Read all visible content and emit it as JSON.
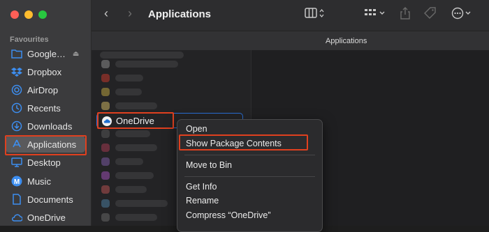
{
  "window": {
    "title": "Applications",
    "path_label": "Applications"
  },
  "sidebar": {
    "section": "Favourites",
    "items": [
      {
        "label": "Google…",
        "icon": "folder-icon"
      },
      {
        "label": "Dropbox",
        "icon": "dropbox-icon"
      },
      {
        "label": "AirDrop",
        "icon": "airdrop-icon"
      },
      {
        "label": "Recents",
        "icon": "clock-icon"
      },
      {
        "label": "Downloads",
        "icon": "download-icon"
      },
      {
        "label": "Applications",
        "icon": "applications-icon"
      },
      {
        "label": "Desktop",
        "icon": "desktop-icon"
      },
      {
        "label": "Music",
        "icon": "music-icon"
      },
      {
        "label": "Documents",
        "icon": "document-icon"
      },
      {
        "label": "OneDrive",
        "icon": "cloud-icon"
      }
    ]
  },
  "filelist": {
    "selected_item": "OneDrive"
  },
  "context_menu": {
    "items": [
      "Open",
      "Show Package Contents",
      "Move to Bin",
      "Get Info",
      "Rename",
      "Compress “OneDrive”"
    ]
  },
  "colors": {
    "accent": "#2a6fd6",
    "highlight": "#e0401f"
  }
}
